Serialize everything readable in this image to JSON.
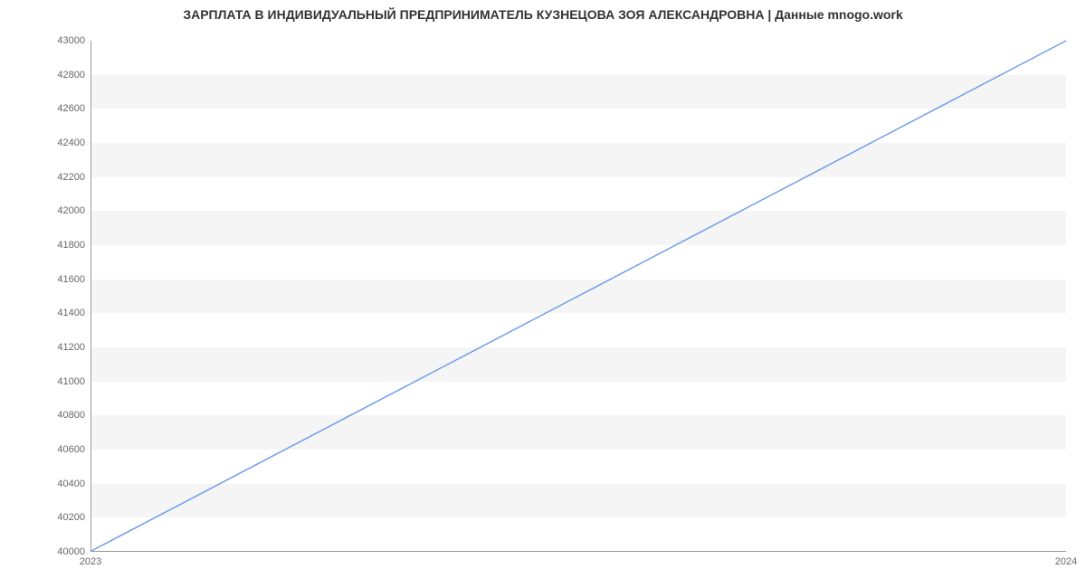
{
  "chart_data": {
    "type": "line",
    "title": "ЗАРПЛАТА В ИНДИВИДУАЛЬНЫЙ ПРЕДПРИНИМАТЕЛЬ КУЗНЕЦОВА ЗОЯ АЛЕКСАНДРОВНА | Данные mnogo.work",
    "xlabel": "",
    "ylabel": "",
    "x_categories": [
      "2023",
      "2024"
    ],
    "x": [
      2023,
      2024
    ],
    "series": [
      {
        "name": "",
        "values": [
          40000,
          43000
        ],
        "color": "#6f9fe8"
      }
    ],
    "ylim": [
      40000,
      43000
    ],
    "y_ticks": [
      40000,
      40200,
      40400,
      40600,
      40800,
      41000,
      41200,
      41400,
      41600,
      41800,
      42000,
      42200,
      42400,
      42600,
      42800,
      43000
    ],
    "grid_bands": true
  }
}
